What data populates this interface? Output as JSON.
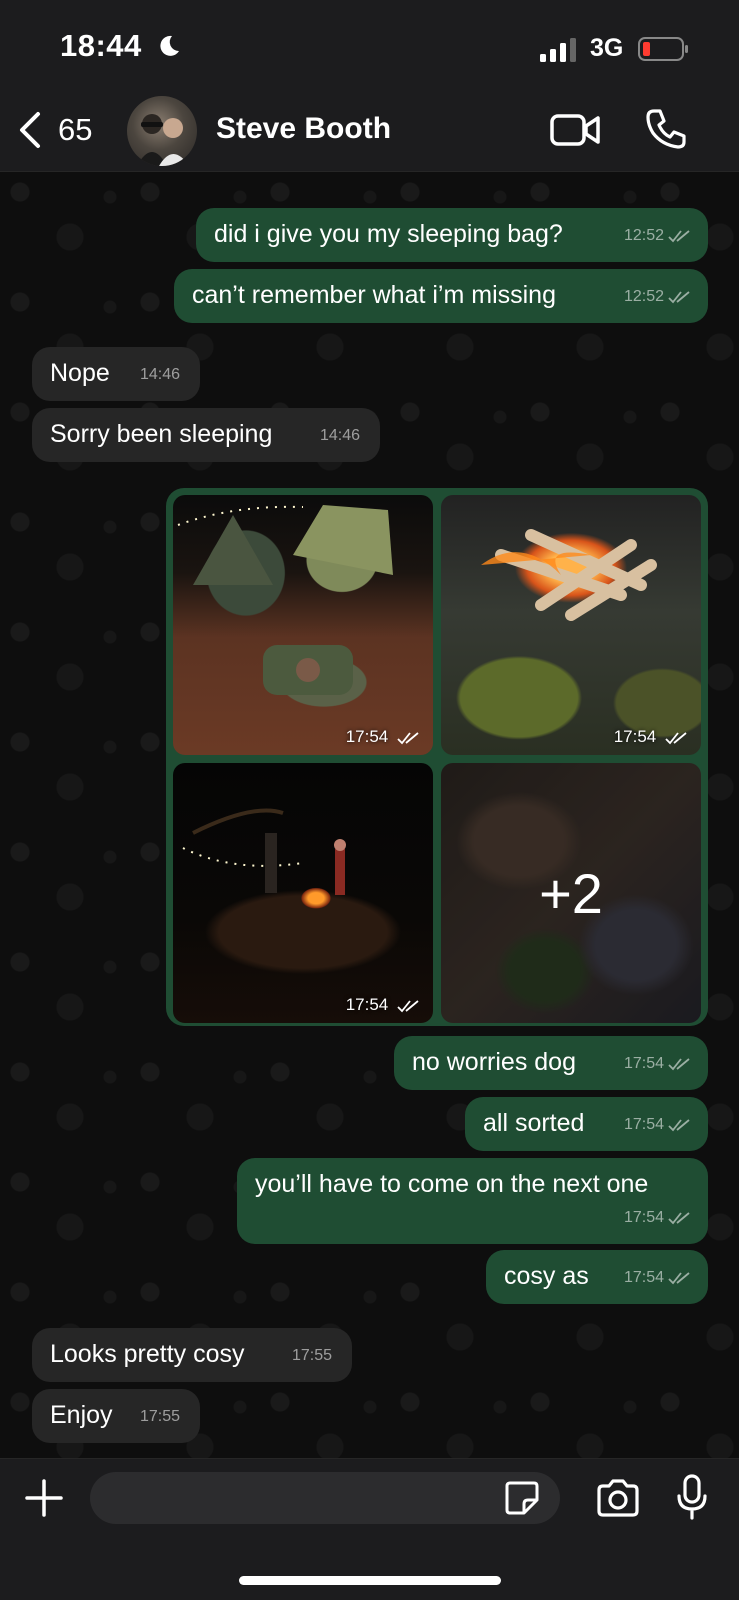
{
  "status_bar": {
    "time": "18:44",
    "network": "3G"
  },
  "header": {
    "back_count": "65",
    "contact_name": "Steve Booth"
  },
  "messages": [
    {
      "dir": "out",
      "text": "did i give you my sleeping bag?",
      "time": "12:52"
    },
    {
      "dir": "out",
      "text": "can’t remember what i’m missing",
      "time": "12:52"
    },
    {
      "dir": "in",
      "text": "Nope",
      "time": "14:46"
    },
    {
      "dir": "in",
      "text": "Sorry been sleeping",
      "time": "14:46"
    },
    {
      "dir": "out",
      "text": "no worries dog",
      "time": "17:54"
    },
    {
      "dir": "out",
      "text": "all sorted",
      "time": "17:54"
    },
    {
      "dir": "out",
      "text": "you’ll have to come on the next one",
      "time": "17:54"
    },
    {
      "dir": "out",
      "text": "cosy as",
      "time": "17:54"
    },
    {
      "dir": "in",
      "text": "Looks pretty cosy",
      "time": "17:55"
    },
    {
      "dir": "in",
      "text": "Enjoy",
      "time": "17:55"
    }
  ],
  "gallery": {
    "photos": [
      {
        "time": "17:54"
      },
      {
        "time": "17:54"
      },
      {
        "time": "17:54"
      }
    ],
    "more_count": "+2"
  },
  "colors": {
    "outgoing": "#1f4d33",
    "incoming": "#262626",
    "bar": "#1c1c1e"
  },
  "icons": [
    "back-chevron-icon",
    "video-call-icon",
    "phone-icon",
    "plus-icon",
    "sticker-icon",
    "camera-icon",
    "microphone-icon",
    "double-check-icon"
  ]
}
